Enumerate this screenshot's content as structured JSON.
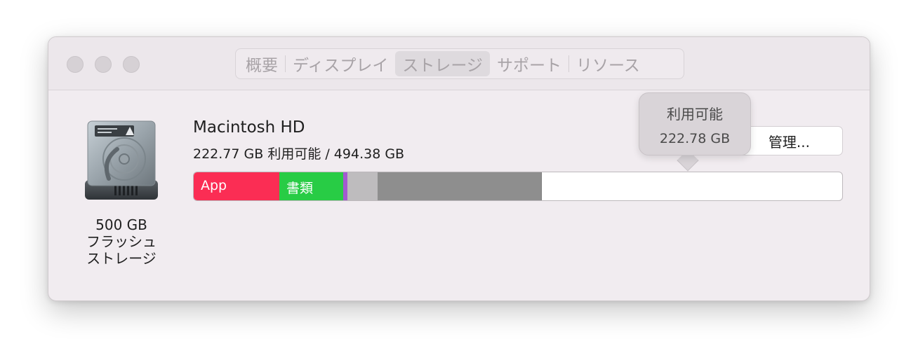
{
  "tabs": [
    {
      "label": "概要",
      "active": false
    },
    {
      "label": "ディスプレイ",
      "active": false
    },
    {
      "label": "ストレージ",
      "active": true
    },
    {
      "label": "サポート",
      "active": false
    },
    {
      "label": "リソース",
      "active": false
    }
  ],
  "drive": {
    "icon": "hard-drive-icon",
    "caption_line1": "500 GB",
    "caption_line2": "フラッシュ",
    "caption_line3": "ストレージ"
  },
  "volume": {
    "name": "Macintosh HD",
    "usage_text": "222.77 GB 利用可能 / 494.38 GB",
    "manage_label": "管理..."
  },
  "storage_bar": {
    "segments": [
      {
        "label": "App",
        "color": "#fb2d54",
        "fraction": 0.132
      },
      {
        "label": "書類",
        "color": "#28cc45",
        "fraction": 0.098
      },
      {
        "label": "",
        "color": "#a35ad0",
        "fraction": 0.006
      },
      {
        "label": "",
        "color": "#bebcbe",
        "fraction": 0.047
      },
      {
        "label": "",
        "color": "#8e8e8e",
        "fraction": 0.253
      }
    ],
    "free_color": "#ffffff"
  },
  "tooltip": {
    "title": "利用可能",
    "value": "222.78 GB"
  }
}
